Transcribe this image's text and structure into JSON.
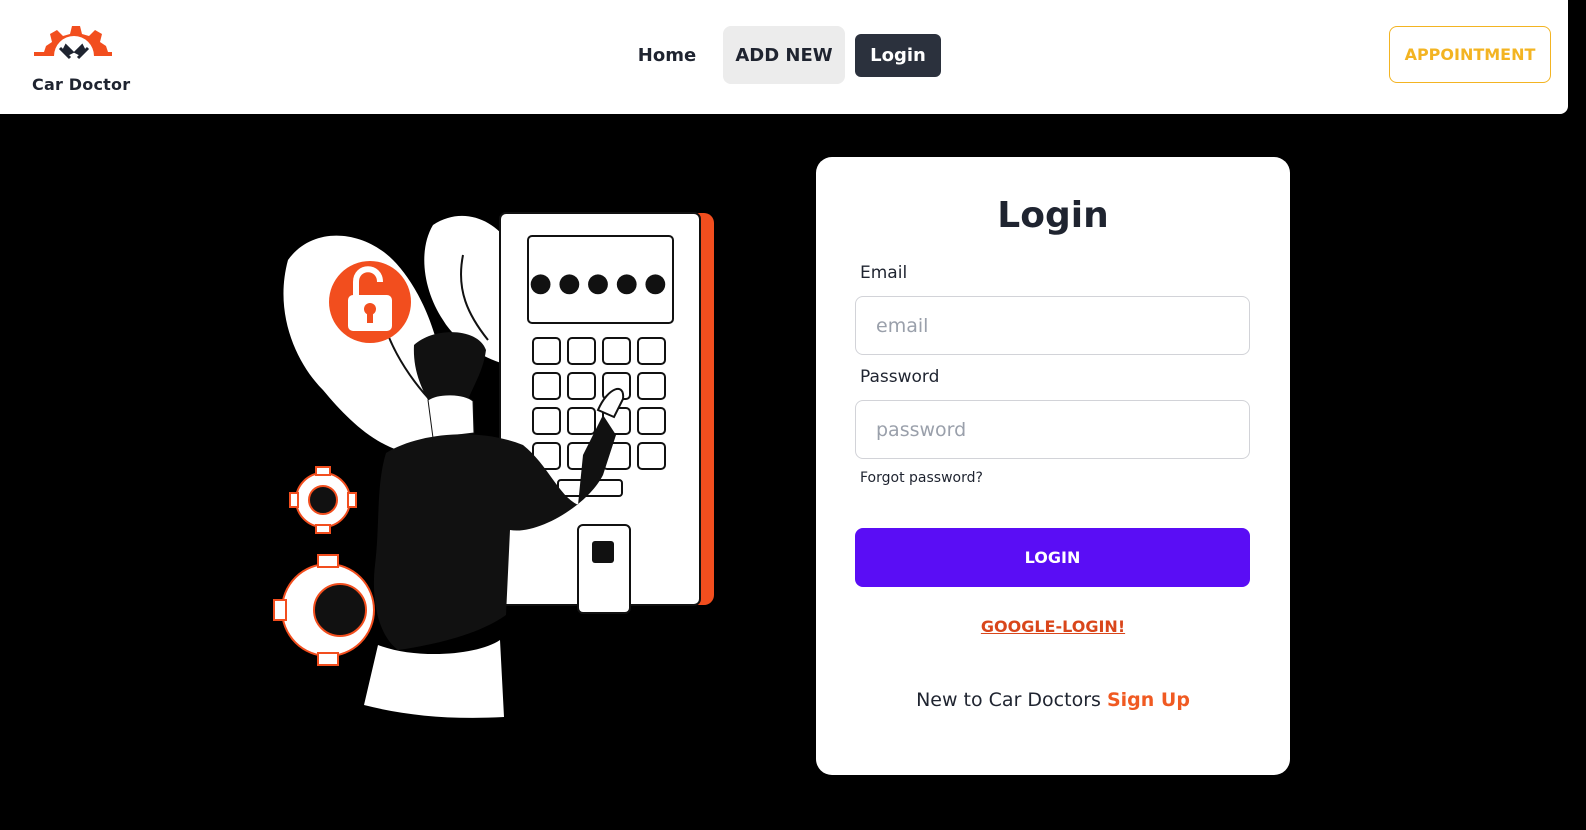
{
  "brand": {
    "name": "Car Doctor",
    "logo_icon": "gear-wrench-logo-icon",
    "accent_color": "#f24e1e"
  },
  "nav": {
    "items": [
      {
        "label": "Home"
      },
      {
        "label": "ADD NEW"
      },
      {
        "label": "Login"
      }
    ],
    "appointment_label": "APPOINTMENT",
    "appointment_color": "#f3b422"
  },
  "illustration": {
    "icon": "unlock-padlock-keypad-illustration",
    "masked_code": "●●●●●"
  },
  "login_form": {
    "title": "Login",
    "email_label": "Email",
    "email_placeholder": "email",
    "email_value": "",
    "password_label": "Password",
    "password_placeholder": "password",
    "password_value": "",
    "forgot_label": "Forgot password?",
    "submit_label": "LOGIN",
    "submit_color": "#5a0df5",
    "google_label": "GOOGLE-LOGIN!",
    "signup_prompt": "New to Car Doctors",
    "signup_link": "Sign Up"
  }
}
